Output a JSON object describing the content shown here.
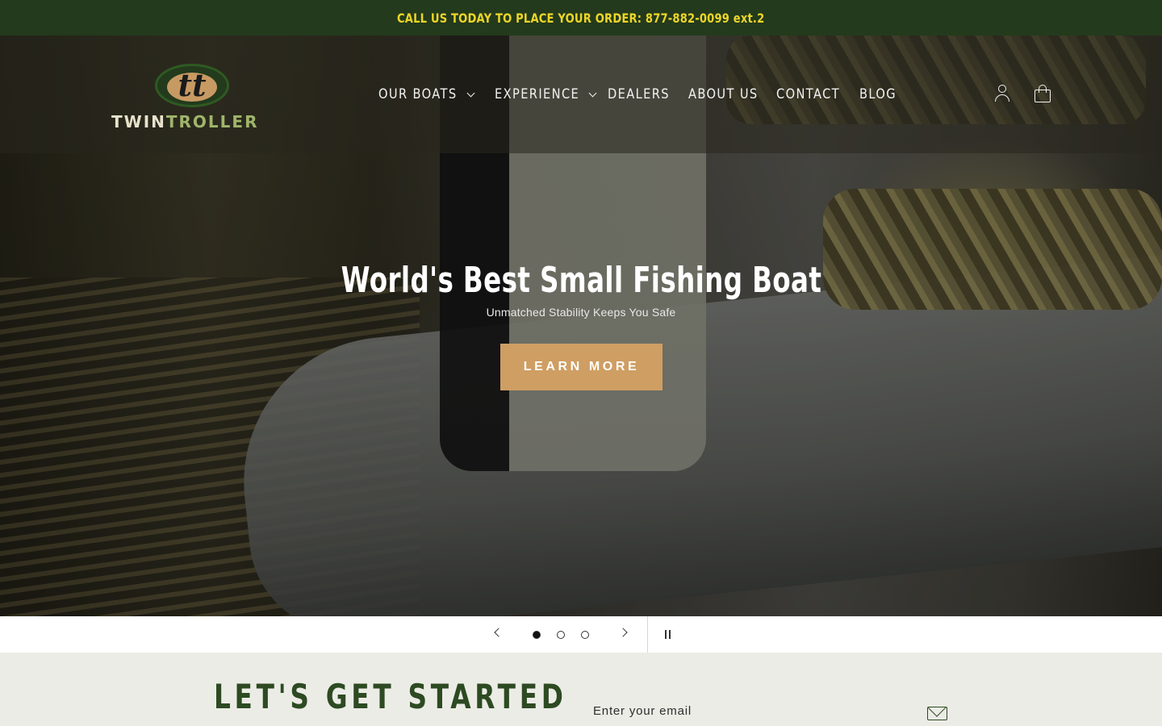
{
  "announcement": {
    "text": "CALL US TODAY TO PLACE YOUR ORDER: 877-882-0099 ext.2",
    "bg": "#233a1c",
    "color": "#ecd528"
  },
  "brand": {
    "logo_letters": "tt",
    "name_part1": "TWIN",
    "name_part2": "TROLLER"
  },
  "nav": {
    "items": [
      {
        "label": "OUR BOATS",
        "has_dropdown": true
      },
      {
        "label": "EXPERIENCE",
        "has_dropdown": true
      },
      {
        "label": "DEALERS",
        "has_dropdown": false
      },
      {
        "label": "ABOUT US",
        "has_dropdown": false
      },
      {
        "label": "CONTACT",
        "has_dropdown": false
      },
      {
        "label": "BLOG",
        "has_dropdown": false
      }
    ]
  },
  "header_icons": {
    "account": "account-icon",
    "cart": "cart-icon"
  },
  "hero": {
    "title": "World's Best Small Fishing Boat",
    "subtitle": "Unmatched Stability Keeps You Safe",
    "button": "LEARN MORE",
    "button_color": "#cf9e63"
  },
  "slider": {
    "total_slides": 3,
    "active_slide": 1
  },
  "newsletter": {
    "title": "LET'S GET STARTED",
    "placeholder": "Enter your email",
    "title_color": "#2d4a22"
  }
}
